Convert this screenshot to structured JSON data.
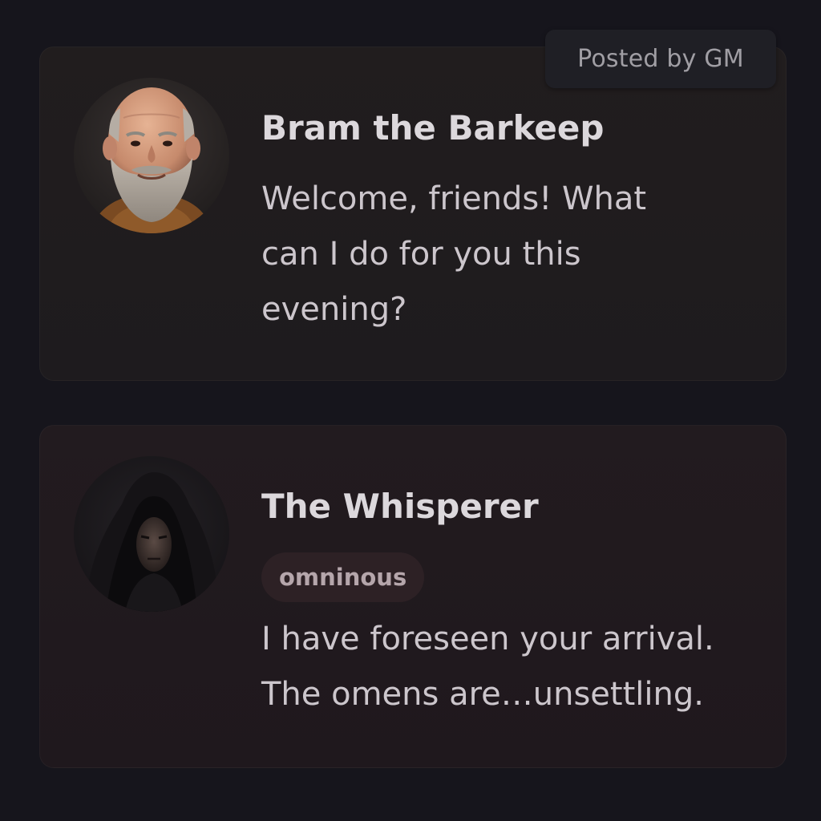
{
  "posted_by": "Posted by GM",
  "posts": [
    {
      "speaker": "Bram the Barkeep",
      "avatar_icon": "barkeep-portrait-icon",
      "tone": null,
      "message": "Welcome, friends! What can I do for you this evening?"
    },
    {
      "speaker": "The Whisperer",
      "avatar_icon": "hooded-figure-portrait-icon",
      "tone": "omninous",
      "message": "I have foreseen your arrival. The omens are…unsettling."
    }
  ],
  "colors": {
    "background": "#16151c",
    "card": "#211d1e",
    "card_alt": "#221b1f",
    "name_text": "#dcd8dc",
    "message_text": "#ccc6cc",
    "tag_bg": "#2d2125",
    "tag_text": "#b5a6ab",
    "badge_bg": "#1f1f25",
    "badge_text": "#a09ea4"
  }
}
